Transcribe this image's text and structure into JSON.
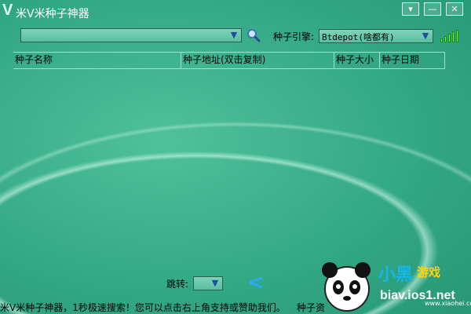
{
  "window": {
    "logo": "V",
    "title": "米V米种子神器",
    "menu_button": "▾",
    "minimize_button": "—",
    "close_button": "✕"
  },
  "search": {
    "value": "",
    "dropdown_icon": "chevron-down-icon",
    "search_icon": "search-icon"
  },
  "engine": {
    "label": "种子引擎:",
    "selected": "Btdepot(啥都有)"
  },
  "table": {
    "columns": [
      "种子名称",
      "种子地址(双击复制)",
      "种子大小",
      "种子日期"
    ],
    "rows": []
  },
  "pagination": {
    "jump_label": "跳转:",
    "jump_value": "",
    "prev_icon": "chevron-left-icon"
  },
  "status": {
    "text": "米V米种子神器，1秒极速搜索！您可以点击右上角支持或赞助我们。",
    "right_text": "种子资"
  },
  "watermark": {
    "brand": "小黑",
    "brand2": "游戏",
    "domain": "biav.ios1.net",
    "url": "www.xiaohei.com"
  },
  "colors": {
    "background": "#33a884",
    "header_line": "#9fe3cc",
    "accent_blue": "#1d4fa0",
    "signal_green": "#6cff2a"
  }
}
